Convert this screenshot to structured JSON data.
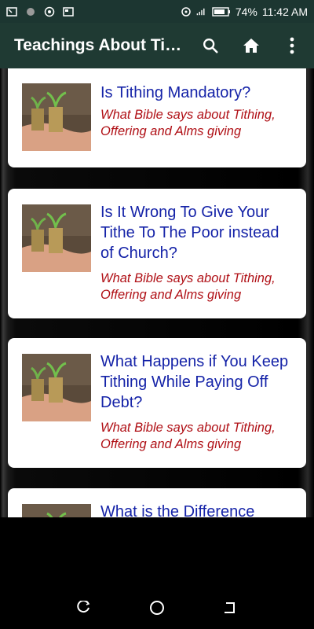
{
  "status_bar": {
    "icons": [
      "screenshot-icon",
      "dot-icon",
      "record-icon",
      "news-icon",
      "hotspot-icon",
      "signal-icon",
      "battery-icon"
    ],
    "battery": "74%",
    "time": "11:42 AM"
  },
  "app_bar": {
    "title": "Teachings About Tithing",
    "actions": [
      "search-icon",
      "home-icon",
      "more-vert-icon"
    ]
  },
  "cards": [
    {
      "title": "Is Tithing Mandatory?",
      "subtitle": "What Bible says about Tithing, Offering and Alms giving"
    },
    {
      "title": "Is It Wrong To Give Your Tithe To The Poor instead of Church?",
      "subtitle": "What Bible says about Tithing, Offering and Alms giving"
    },
    {
      "title": "What Happens if You Keep Tithing While Paying Off Debt?",
      "subtitle": "What Bible says about Tithing, Offering and Alms giving"
    },
    {
      "title": "What is the Difference",
      "subtitle": ""
    }
  ],
  "nav_bar": {
    "buttons": [
      "recents-icon",
      "home-circle-icon",
      "back-icon"
    ]
  },
  "colors": {
    "status_bar": "#1c3631",
    "app_bar": "#1f3a33",
    "title_text": "#1523a8",
    "subtitle_text": "#b01016"
  }
}
